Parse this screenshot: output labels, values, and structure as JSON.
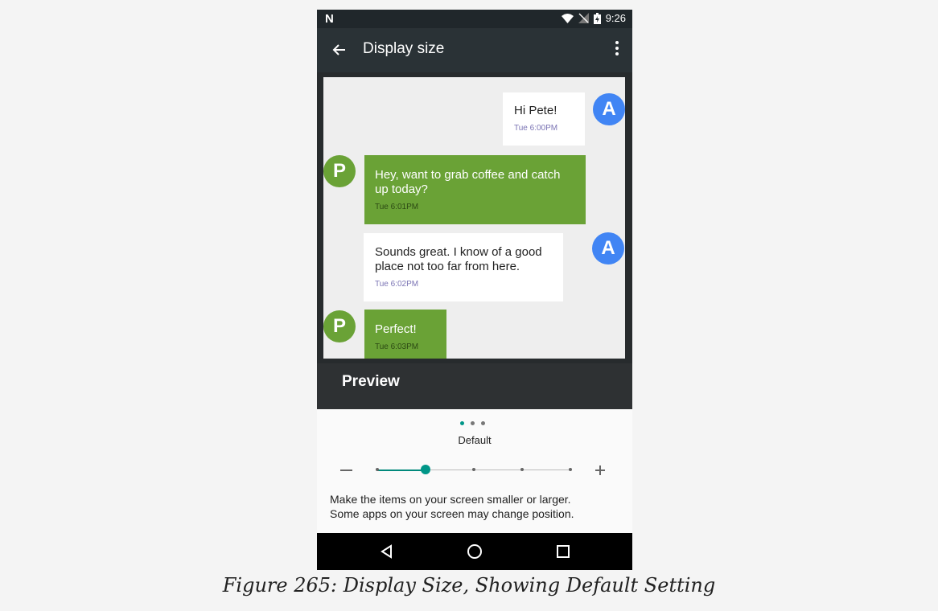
{
  "statusbar": {
    "logo": "N",
    "time": "9:26"
  },
  "toolbar": {
    "title": "Display size",
    "back_icon": "arrow-left-icon",
    "menu_icon": "overflow-menu-icon"
  },
  "messages": [
    {
      "sender": "A",
      "text": "Hi Pete!",
      "time": "Tue 6:00PM"
    },
    {
      "sender": "P",
      "text": "Hey, want to grab coffee and catch up today?",
      "time": "Tue 6:01PM"
    },
    {
      "sender": "A",
      "text": "Sounds great. I know of a good place not too far from here.",
      "time": "Tue 6:02PM"
    },
    {
      "sender": "P",
      "text": "Perfect!",
      "time": "Tue 6:03PM"
    }
  ],
  "preview_label": "Preview",
  "size": {
    "label": "Default",
    "levels": 5,
    "selected_index": 1,
    "page_dots": 3,
    "active_page": 0,
    "help_line1": "Make the items on your screen smaller or larger.",
    "help_line2": "Some apps on your screen may change position."
  },
  "colors": {
    "accent": "#009688",
    "avatar_a": "#4185f4",
    "avatar_p": "#6aa236"
  },
  "caption": "Figure 265: Display Size, Showing Default Setting"
}
